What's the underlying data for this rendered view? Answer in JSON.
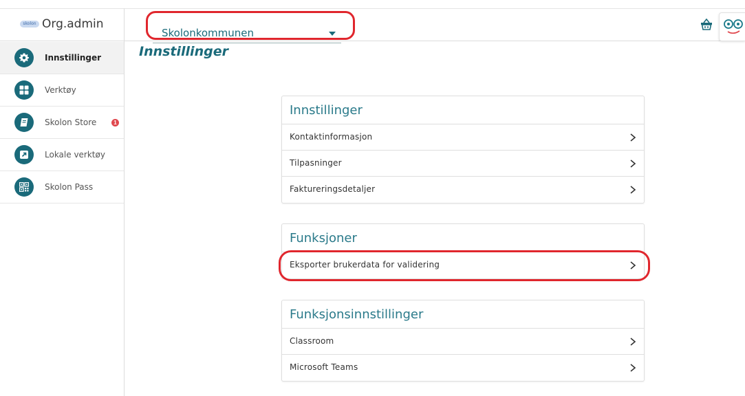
{
  "header": {
    "brand_logo_text": "skolon",
    "brand_title": "Org.admin",
    "org_selector": {
      "value": "Skolonkommunen"
    },
    "cart_icon": "basket-icon",
    "avatar_icon": "face-icon"
  },
  "sidebar": {
    "items": [
      {
        "label": "Innstillinger",
        "icon": "gear-icon",
        "active": true
      },
      {
        "label": "Verktøy",
        "icon": "grid-icon"
      },
      {
        "label": "Skolon Store",
        "icon": "book-icon",
        "badge": "1"
      },
      {
        "label": "Lokale verktøy",
        "icon": "external-link-icon"
      },
      {
        "label": "Skolon Pass",
        "icon": "qr-code-icon"
      }
    ]
  },
  "main": {
    "title": "Innstillinger",
    "cards": [
      {
        "title": "Innstillinger",
        "rows": [
          "Kontaktinformasjon",
          "Tilpasninger",
          "Faktureringsdetaljer"
        ]
      },
      {
        "title": "Funksjoner",
        "rows": [
          "Eksporter brukerdata for validering"
        ]
      },
      {
        "title": "Funksjonsinnstillinger",
        "rows": [
          "Classroom",
          "Microsoft Teams"
        ]
      }
    ]
  },
  "colors": {
    "accent": "#1a6a7a",
    "card_title": "#2a7a8a",
    "annotation": "#e0262d",
    "badge": "#e0484e"
  }
}
